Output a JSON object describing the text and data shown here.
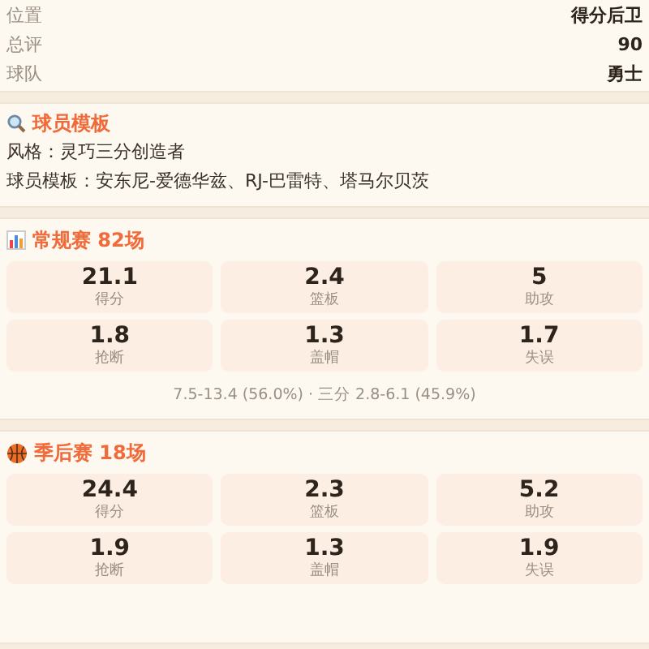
{
  "info_rows": [
    {
      "label": "位置",
      "value": "得分后卫"
    },
    {
      "label": "总评",
      "value": "90"
    },
    {
      "label": "球队",
      "value": "勇士"
    }
  ],
  "template": {
    "title": "球员模板",
    "lines": [
      "风格：灵巧三分创造者",
      "球员模板：安东尼-爱德华兹、RJ-巴雷特、塔马尔贝茨"
    ]
  },
  "sections": [
    {
      "kind": "chart",
      "title": "常规赛 82场",
      "stats": [
        {
          "value": "21.1",
          "label": "得分"
        },
        {
          "value": "2.4",
          "label": "篮板"
        },
        {
          "value": "5",
          "label": "助攻"
        },
        {
          "value": "1.8",
          "label": "抢断"
        },
        {
          "value": "1.3",
          "label": "盖帽"
        },
        {
          "value": "1.7",
          "label": "失误"
        }
      ],
      "footnote": "7.5-13.4 (56.0%) · 三分 2.8-6.1 (45.9%)"
    },
    {
      "kind": "ball",
      "title": "季后赛 18场",
      "stats": [
        {
          "value": "24.4",
          "label": "得分"
        },
        {
          "value": "2.3",
          "label": "篮板"
        },
        {
          "value": "5.2",
          "label": "助攻"
        },
        {
          "value": "1.9",
          "label": "抢断"
        },
        {
          "value": "1.3",
          "label": "盖帽"
        },
        {
          "value": "1.9",
          "label": "失误"
        }
      ]
    }
  ]
}
